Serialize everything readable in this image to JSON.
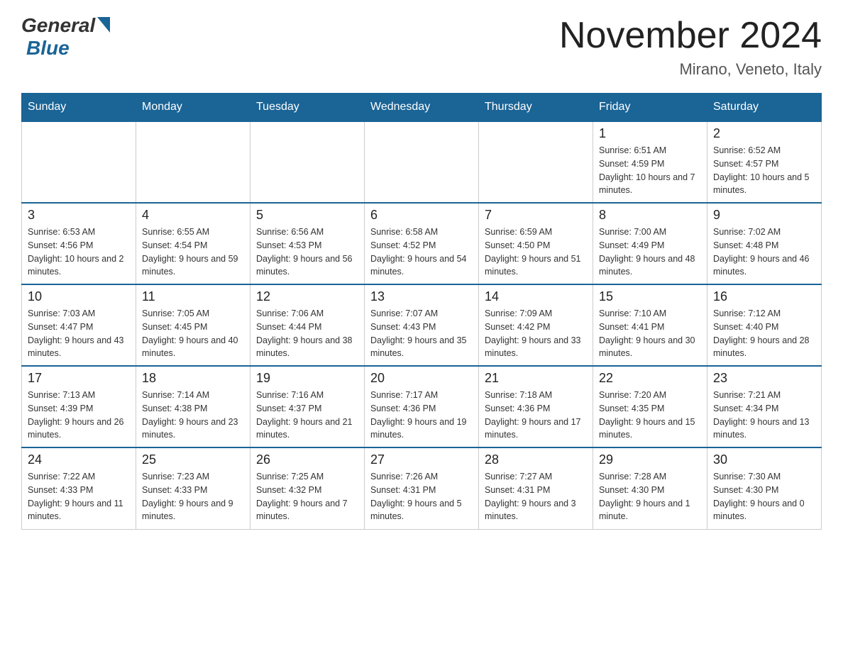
{
  "logo": {
    "general": "General",
    "blue": "Blue"
  },
  "title": "November 2024",
  "subtitle": "Mirano, Veneto, Italy",
  "days_of_week": [
    "Sunday",
    "Monday",
    "Tuesday",
    "Wednesday",
    "Thursday",
    "Friday",
    "Saturday"
  ],
  "weeks": [
    [
      {
        "day": "",
        "info": ""
      },
      {
        "day": "",
        "info": ""
      },
      {
        "day": "",
        "info": ""
      },
      {
        "day": "",
        "info": ""
      },
      {
        "day": "",
        "info": ""
      },
      {
        "day": "1",
        "info": "Sunrise: 6:51 AM\nSunset: 4:59 PM\nDaylight: 10 hours and 7 minutes."
      },
      {
        "day": "2",
        "info": "Sunrise: 6:52 AM\nSunset: 4:57 PM\nDaylight: 10 hours and 5 minutes."
      }
    ],
    [
      {
        "day": "3",
        "info": "Sunrise: 6:53 AM\nSunset: 4:56 PM\nDaylight: 10 hours and 2 minutes."
      },
      {
        "day": "4",
        "info": "Sunrise: 6:55 AM\nSunset: 4:54 PM\nDaylight: 9 hours and 59 minutes."
      },
      {
        "day": "5",
        "info": "Sunrise: 6:56 AM\nSunset: 4:53 PM\nDaylight: 9 hours and 56 minutes."
      },
      {
        "day": "6",
        "info": "Sunrise: 6:58 AM\nSunset: 4:52 PM\nDaylight: 9 hours and 54 minutes."
      },
      {
        "day": "7",
        "info": "Sunrise: 6:59 AM\nSunset: 4:50 PM\nDaylight: 9 hours and 51 minutes."
      },
      {
        "day": "8",
        "info": "Sunrise: 7:00 AM\nSunset: 4:49 PM\nDaylight: 9 hours and 48 minutes."
      },
      {
        "day": "9",
        "info": "Sunrise: 7:02 AM\nSunset: 4:48 PM\nDaylight: 9 hours and 46 minutes."
      }
    ],
    [
      {
        "day": "10",
        "info": "Sunrise: 7:03 AM\nSunset: 4:47 PM\nDaylight: 9 hours and 43 minutes."
      },
      {
        "day": "11",
        "info": "Sunrise: 7:05 AM\nSunset: 4:45 PM\nDaylight: 9 hours and 40 minutes."
      },
      {
        "day": "12",
        "info": "Sunrise: 7:06 AM\nSunset: 4:44 PM\nDaylight: 9 hours and 38 minutes."
      },
      {
        "day": "13",
        "info": "Sunrise: 7:07 AM\nSunset: 4:43 PM\nDaylight: 9 hours and 35 minutes."
      },
      {
        "day": "14",
        "info": "Sunrise: 7:09 AM\nSunset: 4:42 PM\nDaylight: 9 hours and 33 minutes."
      },
      {
        "day": "15",
        "info": "Sunrise: 7:10 AM\nSunset: 4:41 PM\nDaylight: 9 hours and 30 minutes."
      },
      {
        "day": "16",
        "info": "Sunrise: 7:12 AM\nSunset: 4:40 PM\nDaylight: 9 hours and 28 minutes."
      }
    ],
    [
      {
        "day": "17",
        "info": "Sunrise: 7:13 AM\nSunset: 4:39 PM\nDaylight: 9 hours and 26 minutes."
      },
      {
        "day": "18",
        "info": "Sunrise: 7:14 AM\nSunset: 4:38 PM\nDaylight: 9 hours and 23 minutes."
      },
      {
        "day": "19",
        "info": "Sunrise: 7:16 AM\nSunset: 4:37 PM\nDaylight: 9 hours and 21 minutes."
      },
      {
        "day": "20",
        "info": "Sunrise: 7:17 AM\nSunset: 4:36 PM\nDaylight: 9 hours and 19 minutes."
      },
      {
        "day": "21",
        "info": "Sunrise: 7:18 AM\nSunset: 4:36 PM\nDaylight: 9 hours and 17 minutes."
      },
      {
        "day": "22",
        "info": "Sunrise: 7:20 AM\nSunset: 4:35 PM\nDaylight: 9 hours and 15 minutes."
      },
      {
        "day": "23",
        "info": "Sunrise: 7:21 AM\nSunset: 4:34 PM\nDaylight: 9 hours and 13 minutes."
      }
    ],
    [
      {
        "day": "24",
        "info": "Sunrise: 7:22 AM\nSunset: 4:33 PM\nDaylight: 9 hours and 11 minutes."
      },
      {
        "day": "25",
        "info": "Sunrise: 7:23 AM\nSunset: 4:33 PM\nDaylight: 9 hours and 9 minutes."
      },
      {
        "day": "26",
        "info": "Sunrise: 7:25 AM\nSunset: 4:32 PM\nDaylight: 9 hours and 7 minutes."
      },
      {
        "day": "27",
        "info": "Sunrise: 7:26 AM\nSunset: 4:31 PM\nDaylight: 9 hours and 5 minutes."
      },
      {
        "day": "28",
        "info": "Sunrise: 7:27 AM\nSunset: 4:31 PM\nDaylight: 9 hours and 3 minutes."
      },
      {
        "day": "29",
        "info": "Sunrise: 7:28 AM\nSunset: 4:30 PM\nDaylight: 9 hours and 1 minute."
      },
      {
        "day": "30",
        "info": "Sunrise: 7:30 AM\nSunset: 4:30 PM\nDaylight: 9 hours and 0 minutes."
      }
    ]
  ]
}
